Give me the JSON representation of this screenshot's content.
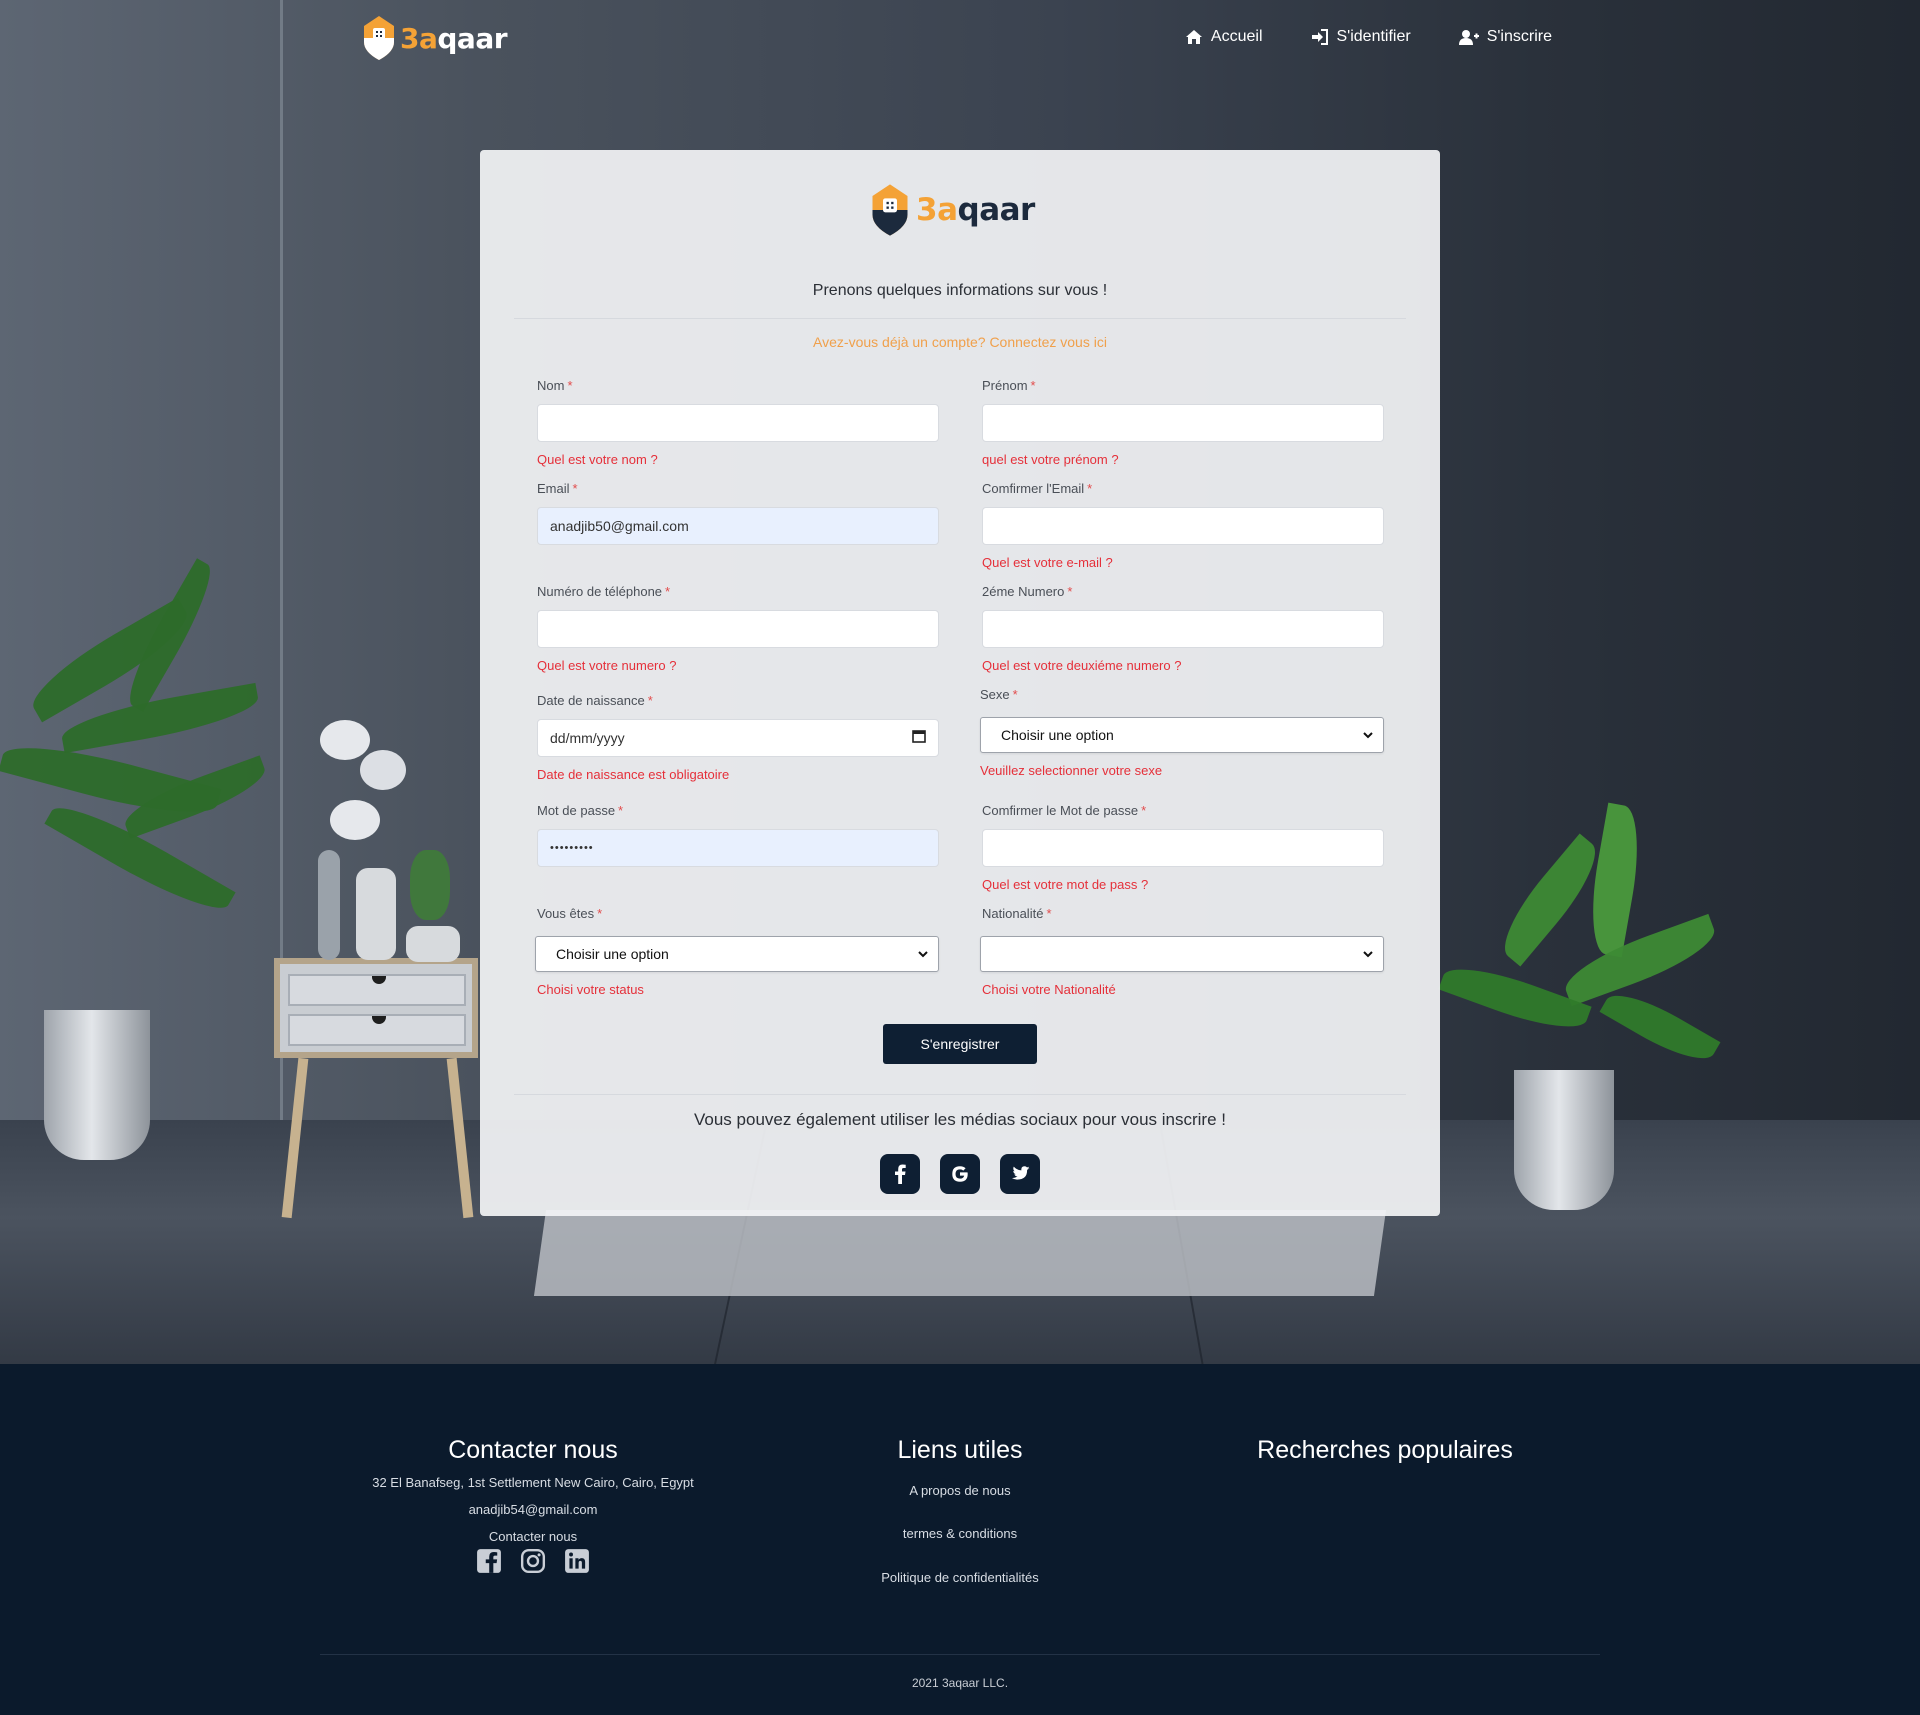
{
  "brand": {
    "part1": "3a",
    "part2": "qaar"
  },
  "nav": {
    "items": [
      {
        "label": "Accueil",
        "icon": "home-icon"
      },
      {
        "label": "S'identifier",
        "icon": "sign-in-icon"
      },
      {
        "label": "S'inscrire",
        "icon": "user-plus-icon"
      }
    ]
  },
  "form": {
    "intro": "Prenons quelques informations sur vous !",
    "login_prompt": "Avez-vous déjà un compte? Connectez vous ici",
    "fields": {
      "nom": {
        "label": "Nom",
        "value": "",
        "error": "Quel est votre nom ?"
      },
      "prenom": {
        "label": "Prénom",
        "value": "",
        "error": "quel est votre prénom ?"
      },
      "email": {
        "label": "Email",
        "value": "anadjib50@gmail.com"
      },
      "confirm_email": {
        "label": "Comfirmer l'Email",
        "value": "",
        "error": "Quel est votre e-mail ?"
      },
      "phone": {
        "label": "Numéro de téléphone",
        "value": "",
        "error": "Quel est votre numero ?"
      },
      "phone2": {
        "label": "2éme Numero",
        "value": "",
        "error": "Quel est votre deuxiéme numero ?"
      },
      "birthdate": {
        "label": "Date de naissance",
        "placeholder": "dd/mm/yyyy",
        "error": "Date de naissance est obligatoire"
      },
      "sexe": {
        "label": "Sexe",
        "selected": "Choisir une option",
        "error": "Veuillez selectionner votre sexe"
      },
      "password": {
        "label": "Mot de passe",
        "value": "•••••••••"
      },
      "confirm_password": {
        "label": "Comfirmer le Mot de passe",
        "value": "",
        "error": "Quel est votre mot de pass ?"
      },
      "status": {
        "label": "Vous êtes",
        "selected": "Choisir une option",
        "error": "Choisi votre status"
      },
      "nationalite": {
        "label": "Nationalité",
        "selected": "",
        "error": "Choisi votre Nationalité"
      }
    },
    "required_mark": "*",
    "submit_label": "S'enregistrer",
    "social_prompt": "Vous pouvez également utiliser les médias sociaux pour vous inscrire !",
    "social_buttons": [
      "facebook-icon",
      "google-icon",
      "twitter-icon"
    ]
  },
  "footer": {
    "contact": {
      "title": "Contacter nous",
      "address": "32 El Banafseg, 1st Settlement New Cairo, Cairo, Egypt",
      "email": "anadjib54@gmail.com",
      "contact_label": "Contacter nous",
      "icons": [
        "facebook-icon",
        "instagram-icon",
        "linkedin-icon"
      ]
    },
    "links": {
      "title": "Liens utiles",
      "items": [
        "A propos de nous",
        "termes & conditions",
        "Politique de confidentialités"
      ]
    },
    "popular": {
      "title": "Recherches populaires"
    },
    "copyright": "2021 3aqaar LLC."
  },
  "colors": {
    "accent": "#f4a236",
    "navy": "#0e1f33",
    "error": "#e5303a",
    "footer_bg": "#0b1a2c"
  }
}
